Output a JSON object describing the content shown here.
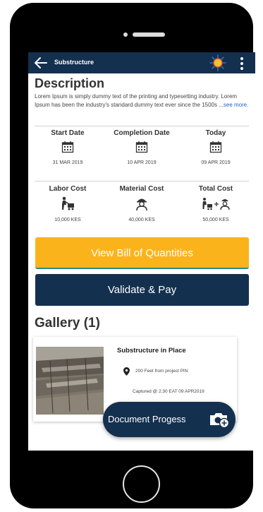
{
  "appbar": {
    "title": "Substructure"
  },
  "description": {
    "heading": "Description",
    "text": "Lorem Ipsum is simply dummy text of the printing and typesetting industry. Lorem Ipsum has been the industry's standard dummy text ever since the 1500s ...",
    "see_more": "see more."
  },
  "dates": [
    {
      "label": "Start Date",
      "value": "31 MAR 2019",
      "icon": "calendar-icon"
    },
    {
      "label": "Completion Date",
      "value": "10 APR 2019",
      "icon": "calendar-icon"
    },
    {
      "label": "Today",
      "value": "09 APR 2019",
      "icon": "calendar-icon"
    }
  ],
  "costs": [
    {
      "label": "Labor Cost",
      "value": "10,000 KES",
      "icon": "worker-cart-icon"
    },
    {
      "label": "Material Cost",
      "value": "40,000 KES",
      "icon": "builder-icon"
    },
    {
      "label": "Total Cost",
      "value": "50,000 KES",
      "icon": "labor-plus-material-icon"
    }
  ],
  "buttons": {
    "bill_of_quantities": "View Bill of Quantities",
    "validate_pay": "Validate & Pay"
  },
  "gallery": {
    "heading": "Gallery (1)",
    "items": [
      {
        "title": "Substructure in Place",
        "location": "200 Feet from project PIN",
        "captured": "Captured @ 2:30 EAT 09 APR2019"
      }
    ]
  },
  "fab": {
    "label": "Document Progess"
  },
  "colors": {
    "navy": "#14304f",
    "yellow": "#fbb31c",
    "link": "#1d64c8"
  }
}
